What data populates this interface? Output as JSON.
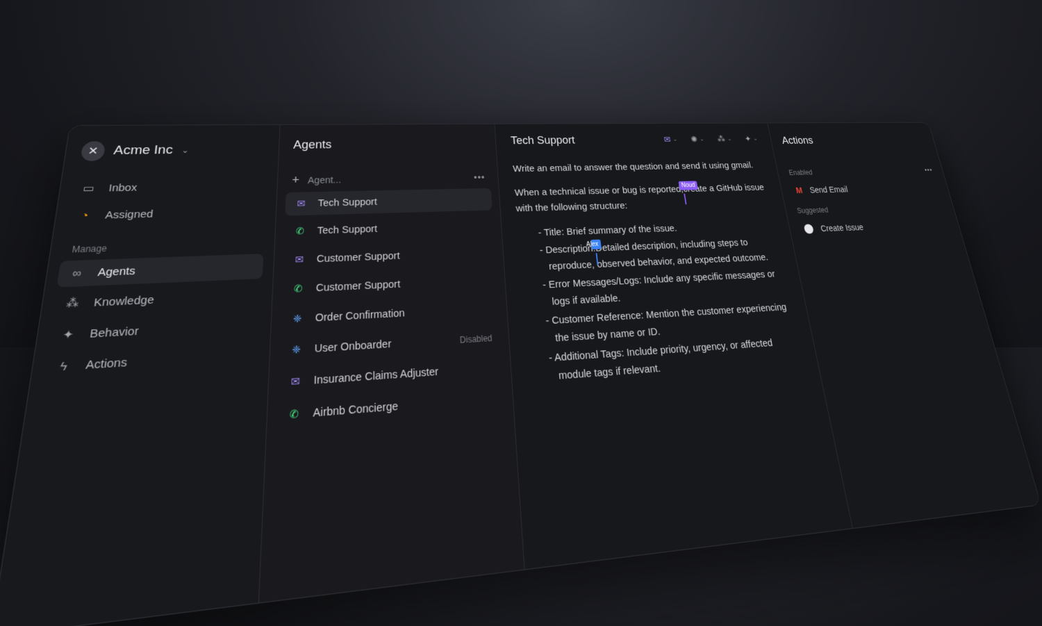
{
  "sidebar": {
    "org_name": "Acme Inc",
    "items_top": [
      {
        "label": "Inbox",
        "icon": "inbox-icon"
      },
      {
        "label": "Assigned",
        "icon": "assigned-icon"
      }
    ],
    "section_label": "Manage",
    "items_manage": [
      {
        "label": "Agents",
        "icon": "agents-icon",
        "active": true
      },
      {
        "label": "Knowledge",
        "icon": "knowledge-icon"
      },
      {
        "label": "Behavior",
        "icon": "behavior-icon"
      },
      {
        "label": "Actions",
        "icon": "actions-icon"
      }
    ]
  },
  "agents": {
    "title": "Agents",
    "add_placeholder": "Agent...",
    "list": [
      {
        "label": "Tech Support",
        "icon": "mail-icon",
        "active": true
      },
      {
        "label": "Tech Support",
        "icon": "phone-icon"
      },
      {
        "label": "Customer Support",
        "icon": "mail-icon"
      },
      {
        "label": "Customer Support",
        "icon": "phone-icon"
      },
      {
        "label": "Order Confirmation",
        "icon": "webhook-icon"
      },
      {
        "label": "User Onboarder",
        "icon": "webhook-icon",
        "status": "Disabled"
      },
      {
        "label": "Insurance Claims Adjuster",
        "icon": "mail-icon"
      },
      {
        "label": "Airbnb Concierge",
        "icon": "phone-icon"
      }
    ]
  },
  "editor": {
    "title": "Tech Support",
    "line1": "Write an email to answer the question and send it using gmail.",
    "line2_a": "When a technical issue or bug is reported,",
    "line2_b": "create a GitHub issue with the following structure:",
    "cursor_noud": "Noud",
    "cursor_alex": "Alex",
    "bullet_title": "- Title: Brief summary of the issue.",
    "bullet_desc_a": "- Description:",
    "bullet_desc_b": "Detailed description, including steps to reproduce, observed behavior, and expected outcome.",
    "bullet_errors": "- Error Messages/Logs: Include any specific messages or logs if available.",
    "bullet_customer": "- Customer Reference: Mention the customer experiencing the issue by name or ID.",
    "bullet_tags": "- Additional Tags: Include priority, urgency, or affected module tags if relevant."
  },
  "actions": {
    "title": "Actions",
    "enabled_label": "Enabled",
    "enabled_items": [
      {
        "label": "Send Email",
        "icon": "gmail-icon"
      }
    ],
    "suggested_label": "Suggested",
    "suggested_items": [
      {
        "label": "Create Issue",
        "icon": "github-icon"
      }
    ]
  },
  "colors": {
    "mail_icon": "#a78bfa",
    "phone_icon": "#4ade80",
    "webhook_icon": "#60a5fa",
    "cursor_noud": "#8b5cf6",
    "cursor_alex": "#3b82f6"
  }
}
